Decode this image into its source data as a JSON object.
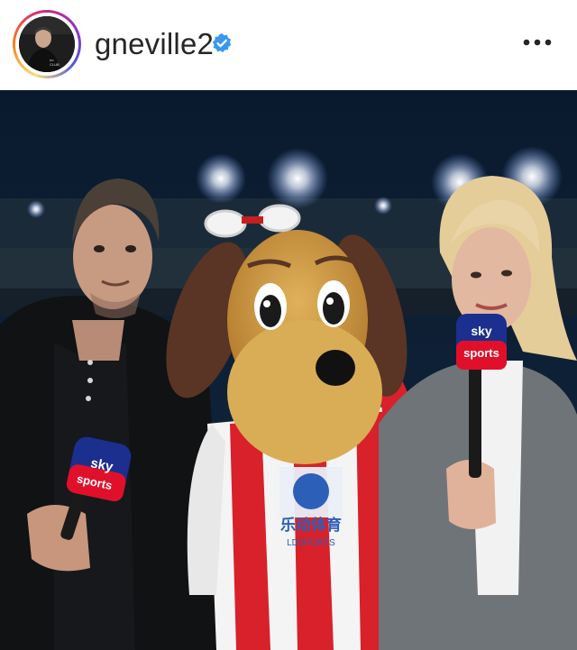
{
  "post_header": {
    "username": "gneville2",
    "verified": true,
    "verified_icon": "verified-badge-icon",
    "more_icon": "more-options-icon"
  },
  "avatar_caption": "no\nCLUB",
  "photo": {
    "mic_left_text_top": "sky",
    "mic_left_text_bottom": "sports",
    "mic_right_text_top": "sky",
    "mic_right_text_bottom": "sports",
    "sponsor_text": "乐动体育",
    "sponsor_subtext": "LDSPORTS"
  },
  "colors": {
    "verified_blue": "#3897f0",
    "sky_red": "#e0102b",
    "sky_blue": "#1b2f8f",
    "kit_red": "#d8212a"
  }
}
